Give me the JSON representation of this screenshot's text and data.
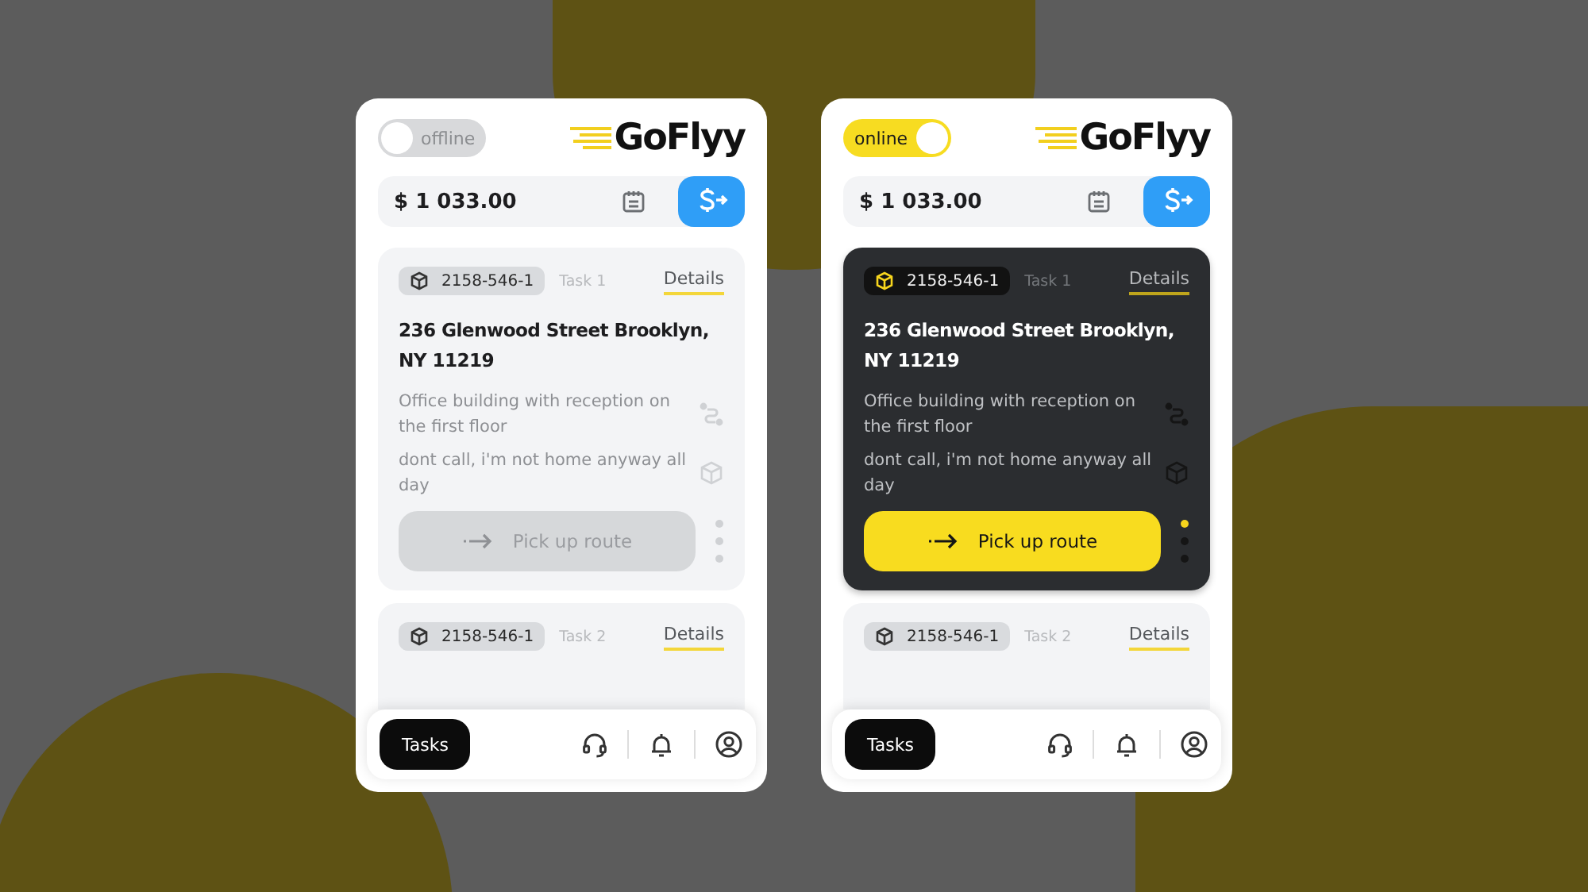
{
  "screens": [
    {
      "status": {
        "label": "offline",
        "on": false
      },
      "logo": "GoFlyy",
      "balance": "$ 1 033.00",
      "tasks": [
        {
          "code": "2158-546-1",
          "task": "Task 1",
          "details": "Details",
          "address": "236 Glenwood Street Brooklyn, NY 11219",
          "notes": [
            "Office building with reception on the first floor",
            "dont call, i'm not home anyway all day"
          ],
          "action": "Pick up route",
          "active": false
        },
        {
          "code": "2158-546-1",
          "task": "Task 2",
          "details": "Details",
          "active": false
        }
      ],
      "nav": {
        "label": "Tasks",
        "selected": true
      }
    },
    {
      "status": {
        "label": "online",
        "on": true
      },
      "logo": "GoFlyy",
      "balance": "$ 1 033.00",
      "tasks": [
        {
          "code": "2158-546-1",
          "task": "Task 1",
          "details": "Details",
          "address": "236 Glenwood Street Brooklyn, NY 11219",
          "notes": [
            "Office building with reception on the first floor",
            "dont call, i'm not home anyway all day"
          ],
          "action": "Pick up route",
          "active": true
        },
        {
          "code": "2158-546-1",
          "task": "Task 2",
          "details": "Details",
          "active": false
        }
      ],
      "nav": {
        "label": "Tasks",
        "selected": true
      }
    }
  ]
}
